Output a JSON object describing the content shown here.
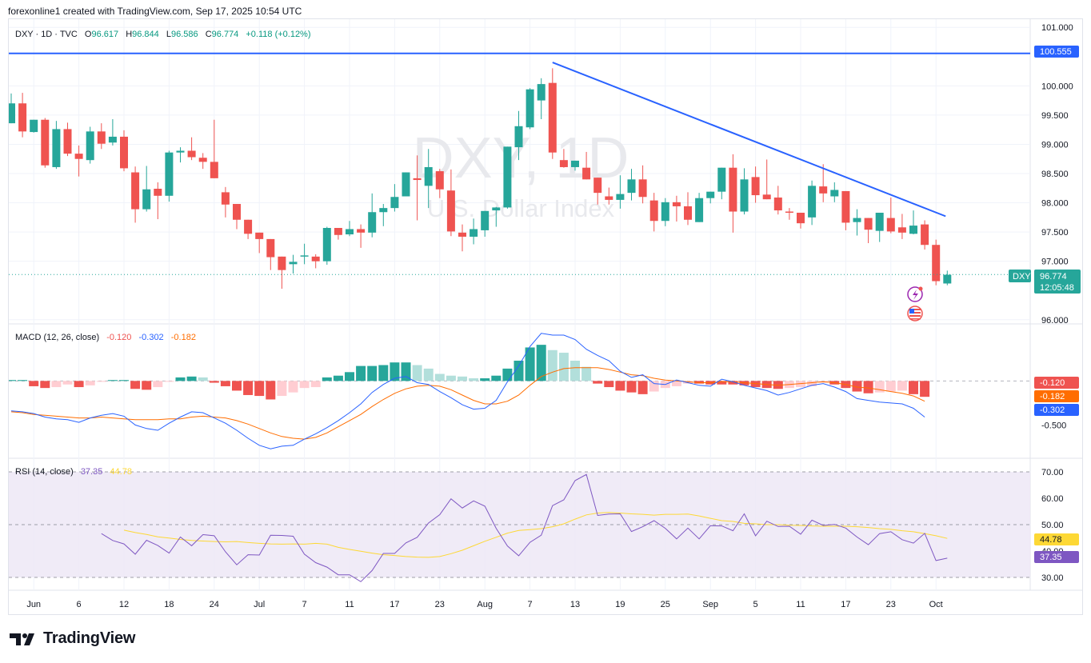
{
  "header": {
    "caption": "forexonline1 created with TradingView.com, Sep 17, 2025 10:54 UTC"
  },
  "legend": {
    "symbol": "DXY · 1D · TVC",
    "o_label": "O",
    "o": "96.617",
    "h_label": "H",
    "h": "96.844",
    "l_label": "L",
    "l": "96.586",
    "c_label": "C",
    "c": "96.774",
    "change": "+0.118 (+0.12%)"
  },
  "watermark": {
    "ticker": "DXY, 1D",
    "name": "U.S. Dollar Index"
  },
  "price_badges": {
    "hline": "100.555",
    "symbol": "DXY",
    "last": "96.774",
    "countdown": "12:05:48"
  },
  "macd_legend": {
    "label": "MACD (12, 26, close)",
    "hist": "-0.120",
    "macd": "-0.302",
    "signal": "-0.182"
  },
  "rsi_legend": {
    "label": "RSI (14, close)",
    "rsi": "37.35",
    "ma": "44.78"
  },
  "footer": {
    "brand": "TradingView"
  },
  "colors": {
    "up": "#26a69a",
    "down": "#ef5350",
    "line_blue": "#2962ff",
    "macd_line": "#2962ff",
    "signal_line": "#ff6d00",
    "rsi_line": "#7e57c2",
    "rsi_ma": "#fdd835",
    "rsi_band": "#ede7f6"
  },
  "chart_data": [
    {
      "type": "candlestick",
      "title": "DXY · 1D · TVC",
      "y_ticks": [
        "101.000",
        "100.000",
        "99.500",
        "99.000",
        "98.500",
        "98.000",
        "97.500",
        "97.000",
        "96.000"
      ],
      "ylim": [
        95.97,
        101.03
      ],
      "x_ticks": [
        "Jun",
        "6",
        "12",
        "18",
        "24",
        "Jul",
        "7",
        "11",
        "17",
        "23",
        "Aug",
        "7",
        "13",
        "19",
        "25",
        "Sep",
        "5",
        "11",
        "17",
        "23",
        "Oct"
      ],
      "x_tick_slots": [
        2,
        6,
        10,
        14,
        18,
        22,
        26,
        30,
        34,
        38,
        42,
        46,
        50,
        54,
        58,
        62,
        66,
        70,
        74,
        78,
        82
      ],
      "candles": [
        [
          99.36,
          99.7,
          99.51,
          99.87
        ],
        [
          99.7,
          99.22,
          99.12,
          99.88
        ],
        [
          99.21,
          99.42,
          99.42,
          99.2
        ],
        [
          99.42,
          98.64,
          98.6,
          99.45
        ],
        [
          98.61,
          99.26,
          99.4,
          98.58
        ],
        [
          99.26,
          98.84,
          98.8,
          99.37
        ],
        [
          98.84,
          98.75,
          98.45,
          98.98
        ],
        [
          98.73,
          99.22,
          99.3,
          98.67
        ],
        [
          99.22,
          99.01,
          98.92,
          99.36
        ],
        [
          99.03,
          99.13,
          99.43,
          98.98
        ],
        [
          99.13,
          98.59,
          98.54,
          99.24
        ],
        [
          98.52,
          97.89,
          97.66,
          98.62
        ],
        [
          97.89,
          98.23,
          98.63,
          97.85
        ],
        [
          98.24,
          98.12,
          97.72,
          98.35
        ],
        [
          98.12,
          98.86,
          98.89,
          98.02
        ],
        [
          98.86,
          98.89,
          98.95,
          98.69
        ],
        [
          98.89,
          98.78,
          99.12,
          98.73
        ],
        [
          98.77,
          98.7,
          98.85,
          98.58
        ],
        [
          98.7,
          98.42,
          98.46,
          99.42
        ],
        [
          98.18,
          97.97,
          98.27,
          97.75
        ],
        [
          97.98,
          97.71,
          97.98,
          97.55
        ],
        [
          97.71,
          97.47,
          97.71,
          97.38
        ],
        [
          97.49,
          97.38,
          97.37,
          97.14
        ],
        [
          97.38,
          97.07,
          97.21,
          96.85
        ],
        [
          97.08,
          96.85,
          96.98,
          96.53
        ],
        [
          96.95,
          96.99,
          97.11,
          96.79
        ],
        [
          97.08,
          97.1,
          97.3,
          96.95
        ],
        [
          97.08,
          97.0,
          97.12,
          96.88
        ],
        [
          97.0,
          97.57,
          97.59,
          96.94
        ],
        [
          97.57,
          97.45,
          97.47,
          97.37
        ],
        [
          97.46,
          97.55,
          97.69,
          97.43
        ],
        [
          97.55,
          97.49,
          97.63,
          97.23
        ],
        [
          97.49,
          97.84,
          98.16,
          97.41
        ],
        [
          97.84,
          97.91,
          97.98,
          97.6
        ],
        [
          97.91,
          98.1,
          98.32,
          97.85
        ],
        [
          98.11,
          98.52,
          98.51,
          98.22
        ],
        [
          98.42,
          98.39,
          98.81,
          97.7
        ],
        [
          98.29,
          98.61,
          98.92,
          97.91
        ],
        [
          98.54,
          98.23,
          98.58,
          98.08
        ],
        [
          98.21,
          97.51,
          98.57,
          97.43
        ],
        [
          97.49,
          97.42,
          97.63,
          97.17
        ],
        [
          97.42,
          97.55,
          97.73,
          97.29
        ],
        [
          97.53,
          97.86,
          97.85,
          97.42
        ],
        [
          97.87,
          97.92,
          97.93,
          97.59
        ],
        [
          97.92,
          98.96,
          98.9,
          97.9
        ],
        [
          98.95,
          99.31,
          99.57,
          98.73
        ],
        [
          99.29,
          99.94,
          99.96,
          99.26
        ],
        [
          99.75,
          100.03,
          100.13,
          99.43
        ],
        [
          100.05,
          98.86,
          100.3,
          98.75
        ],
        [
          98.73,
          98.61,
          98.92,
          98.6
        ],
        [
          98.61,
          98.72,
          98.67,
          98.55
        ],
        [
          98.6,
          98.4,
          98.87,
          98.5
        ],
        [
          98.43,
          98.17,
          98.41,
          97.97
        ],
        [
          98.11,
          98.05,
          98.26,
          97.97
        ],
        [
          98.05,
          98.15,
          98.47,
          97.9
        ],
        [
          98.17,
          98.4,
          98.58,
          98.04
        ],
        [
          98.4,
          98.1,
          98.64,
          97.99
        ],
        [
          98.04,
          97.69,
          98.17,
          97.51
        ],
        [
          97.69,
          98.01,
          98.08,
          97.6
        ],
        [
          98.01,
          97.94,
          98.12,
          97.68
        ],
        [
          97.94,
          97.71,
          98.18,
          97.62
        ],
        [
          97.67,
          98.08,
          98.17,
          97.84
        ],
        [
          98.08,
          98.19,
          98.07,
          97.99
        ],
        [
          98.19,
          98.6,
          98.59,
          98.06
        ],
        [
          98.6,
          97.85,
          98.83,
          97.49
        ],
        [
          97.85,
          98.4,
          98.59,
          97.8
        ],
        [
          98.44,
          98.13,
          98.62,
          98.0
        ],
        [
          98.14,
          98.06,
          98.74,
          98.15
        ],
        [
          98.09,
          97.87,
          98.29,
          97.8
        ],
        [
          97.85,
          97.83,
          97.91,
          97.71
        ],
        [
          97.83,
          97.65,
          97.78,
          97.56
        ],
        [
          97.75,
          98.29,
          98.38,
          97.62
        ],
        [
          98.28,
          98.16,
          98.66,
          98.01
        ],
        [
          98.11,
          98.22,
          98.35,
          98.01
        ],
        [
          98.2,
          97.66,
          98.13,
          97.53
        ],
        [
          97.67,
          97.74,
          97.89,
          97.44
        ],
        [
          97.74,
          97.54,
          97.65,
          97.31
        ],
        [
          97.52,
          97.83,
          97.75,
          97.33
        ],
        [
          97.74,
          97.51,
          98.09,
          97.48
        ],
        [
          97.58,
          97.49,
          97.81,
          97.38
        ],
        [
          97.47,
          97.61,
          97.87,
          97.46
        ],
        [
          97.63,
          97.28,
          97.7,
          97.2
        ],
        [
          97.28,
          96.66,
          97.37,
          96.59
        ],
        [
          96.62,
          96.77,
          96.84,
          96.59
        ]
      ],
      "horizontal_line": 100.555,
      "trend_line": [
        [
          48,
          100.4
        ],
        [
          82,
          97.77
        ]
      ],
      "last_price": 96.774
    },
    {
      "type": "line",
      "title": "MACD (12, 26, close)",
      "y_ticks": [
        "0.000",
        "-0.500"
      ],
      "series": [
        {
          "name": "-0.120",
          "kind": "histogram"
        },
        {
          "name": "-0.302",
          "kind": "macd"
        },
        {
          "name": "-0.182",
          "kind": "signal"
        }
      ],
      "macd": [
        -0.34,
        -0.35,
        -0.37,
        -0.41,
        -0.43,
        -0.44,
        -0.47,
        -0.42,
        -0.39,
        -0.37,
        -0.4,
        -0.5,
        -0.54,
        -0.56,
        -0.48,
        -0.41,
        -0.35,
        -0.36,
        -0.42,
        -0.48,
        -0.56,
        -0.65,
        -0.73,
        -0.77,
        -0.74,
        -0.73,
        -0.66,
        -0.6,
        -0.53,
        -0.45,
        -0.36,
        -0.26,
        -0.13,
        -0.04,
        0.03,
        0.05,
        -0.02,
        -0.04,
        -0.12,
        -0.19,
        -0.27,
        -0.32,
        -0.31,
        -0.22,
        -0.01,
        0.17,
        0.39,
        0.54,
        0.52,
        0.52,
        0.47,
        0.36,
        0.29,
        0.23,
        0.11,
        0.04,
        0.07,
        -0.03,
        -0.04,
        0.01,
        -0.02,
        -0.05,
        -0.06,
        0.02,
        -0.01,
        -0.05,
        -0.08,
        -0.11,
        -0.16,
        -0.13,
        -0.09,
        -0.05,
        -0.03,
        -0.07,
        -0.12,
        -0.2,
        -0.22,
        -0.24,
        -0.25,
        -0.26,
        -0.31,
        -0.41
      ],
      "signal": [
        -0.35,
        -0.36,
        -0.38,
        -0.39,
        -0.4,
        -0.41,
        -0.42,
        -0.42,
        -0.41,
        -0.42,
        -0.43,
        -0.44,
        -0.44,
        -0.44,
        -0.43,
        -0.43,
        -0.41,
        -0.4,
        -0.41,
        -0.42,
        -0.45,
        -0.49,
        -0.54,
        -0.59,
        -0.63,
        -0.65,
        -0.66,
        -0.64,
        -0.59,
        -0.52,
        -0.45,
        -0.38,
        -0.29,
        -0.21,
        -0.14,
        -0.09,
        -0.06,
        -0.05,
        -0.06,
        -0.1,
        -0.16,
        -0.22,
        -0.26,
        -0.26,
        -0.23,
        -0.16,
        -0.05,
        0.05,
        0.1,
        0.14,
        0.15,
        0.15,
        0.15,
        0.13,
        0.1,
        0.07,
        0.06,
        0.03,
        0.01,
        0.0,
        -0.01,
        -0.02,
        -0.02,
        -0.01,
        -0.01,
        -0.02,
        -0.03,
        -0.04,
        -0.05,
        -0.04,
        -0.03,
        -0.02,
        -0.01,
        -0.02,
        -0.04,
        -0.07,
        -0.08,
        -0.1,
        -0.12,
        -0.14,
        -0.17,
        -0.23
      ],
      "hist": [
        0.01,
        0.01,
        -0.06,
        -0.08,
        -0.07,
        -0.04,
        -0.07,
        -0.05,
        -0.01,
        0.01,
        0.01,
        -0.09,
        -0.1,
        -0.07,
        -0.01,
        0.04,
        0.05,
        0.04,
        -0.02,
        -0.06,
        -0.11,
        -0.16,
        -0.17,
        -0.21,
        -0.17,
        -0.13,
        -0.08,
        -0.07,
        0.04,
        0.06,
        0.1,
        0.17,
        0.17,
        0.18,
        0.21,
        0.21,
        0.18,
        0.14,
        0.08,
        0.06,
        0.05,
        0.03,
        0.03,
        0.06,
        0.14,
        0.23,
        0.38,
        0.41,
        0.35,
        0.32,
        0.23,
        0.16,
        -0.03,
        -0.07,
        -0.11,
        -0.13,
        -0.15,
        -0.12,
        -0.08,
        -0.06,
        -0.03,
        -0.03,
        -0.04,
        -0.04,
        -0.04,
        -0.05,
        -0.07,
        -0.08,
        -0.09,
        -0.08,
        -0.07,
        -0.06,
        -0.02,
        -0.04,
        -0.08,
        -0.12,
        -0.14,
        -0.13,
        -0.12,
        -0.11,
        -0.15,
        -0.18
      ]
    },
    {
      "type": "line",
      "title": "RSI (14, close)",
      "y_ticks": [
        "70.00",
        "60.00",
        "50.00",
        "40.00",
        "30.00"
      ],
      "ylim": [
        30,
        70
      ],
      "series": [
        {
          "name": "37.35",
          "kind": "rsi"
        },
        {
          "name": "44.78",
          "kind": "ma"
        }
      ],
      "rsi": [
        46.6,
        44.0,
        42.7,
        38.8,
        44.1,
        42.1,
        39.2,
        45.3,
        42.0,
        46.2,
        45.8,
        39.7,
        34.8,
        38.6,
        38.5,
        46.0,
        45.9,
        45.6,
        38.8,
        35.6,
        33.9,
        31.0,
        31.0,
        28.4,
        32.6,
        39.1,
        39.1,
        43.1,
        45.2,
        50.6,
        53.8,
        59.8,
        56.3,
        59.0,
        57.0,
        48.6,
        41.9,
        38.2,
        43.3,
        46.0,
        57.2,
        59.4,
        66.7,
        69.0,
        53.5,
        54.0,
        54.1,
        47.4,
        49.2,
        51.5,
        48.6,
        44.6,
        48.7,
        44.6,
        49.6,
        49.5,
        47.7,
        54.1,
        45.8,
        51.3,
        49.3,
        49.4,
        46.4,
        51.7,
        49.7,
        50.1,
        48.7,
        45.3,
        42.4,
        46.6,
        47.3,
        44.3,
        43.0,
        46.7,
        36.4,
        37.3
      ],
      "rsi_ma": [
        47.9,
        47.0,
        46.3,
        45.4,
        44.9,
        44.4,
        44.0,
        43.8,
        43.6,
        43.5,
        43.6,
        43.2,
        42.9,
        42.7,
        42.6,
        42.7,
        42.6,
        42.9,
        42.6,
        41.4,
        40.6,
        39.9,
        39.2,
        38.6,
        38.3,
        37.9,
        37.7,
        37.6,
        37.9,
        39.0,
        40.3,
        42.0,
        43.7,
        45.2,
        46.8,
        47.8,
        48.1,
        48.5,
        49.2,
        50.3,
        52.1,
        53.7,
        54.4,
        54.6,
        54.4,
        54.1,
        53.9,
        53.6,
        53.9,
        53.9,
        54.0,
        53.3,
        52.4,
        51.5,
        51.2,
        50.5,
        50.3,
        50.0,
        50.0,
        49.8,
        49.7,
        49.5,
        49.4,
        49.4,
        49.4,
        49.2,
        48.9,
        48.5,
        48.2,
        47.7,
        47.3,
        46.6,
        45.8,
        44.8
      ],
      "bands": [
        70,
        50,
        30
      ]
    }
  ]
}
